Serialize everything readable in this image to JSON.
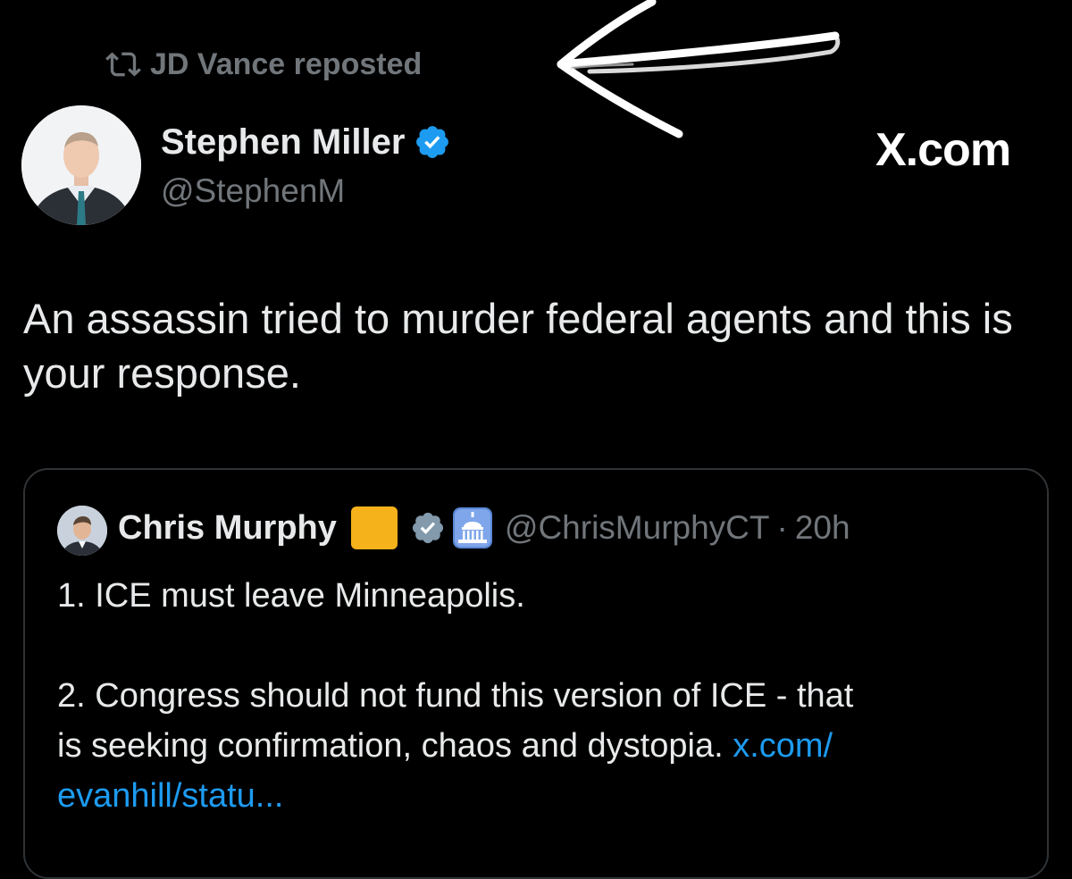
{
  "repost": {
    "icon": "repost-icon",
    "text": "JD Vance reposted"
  },
  "author": {
    "name": "Stephen Miller",
    "handle": "@StephenM",
    "verified": true,
    "avatar": "avatar"
  },
  "watermark": {
    "text": "X.com"
  },
  "tweet": {
    "text": "An assassin tried to murder federal agents and this is your response."
  },
  "quote": {
    "name": "Chris Murphy",
    "handle": "@ChrisMurphyCT",
    "separator": "·",
    "time": "20h",
    "lines": [
      "1. ICE must leave Minneapolis.",
      "2. Congress should not fund this version of ICE - that",
      "is seeking confirmation, chaos and dystopia."
    ],
    "link_part1": "x.com/",
    "link_part2": "evanhill/statu..."
  },
  "colors": {
    "background": "#000000",
    "text": "#e7e9ea",
    "muted": "#71767b",
    "link": "#1d9bf0",
    "verified": "#1d9bf0",
    "border": "#2f3336",
    "square": "#f6b21b"
  }
}
